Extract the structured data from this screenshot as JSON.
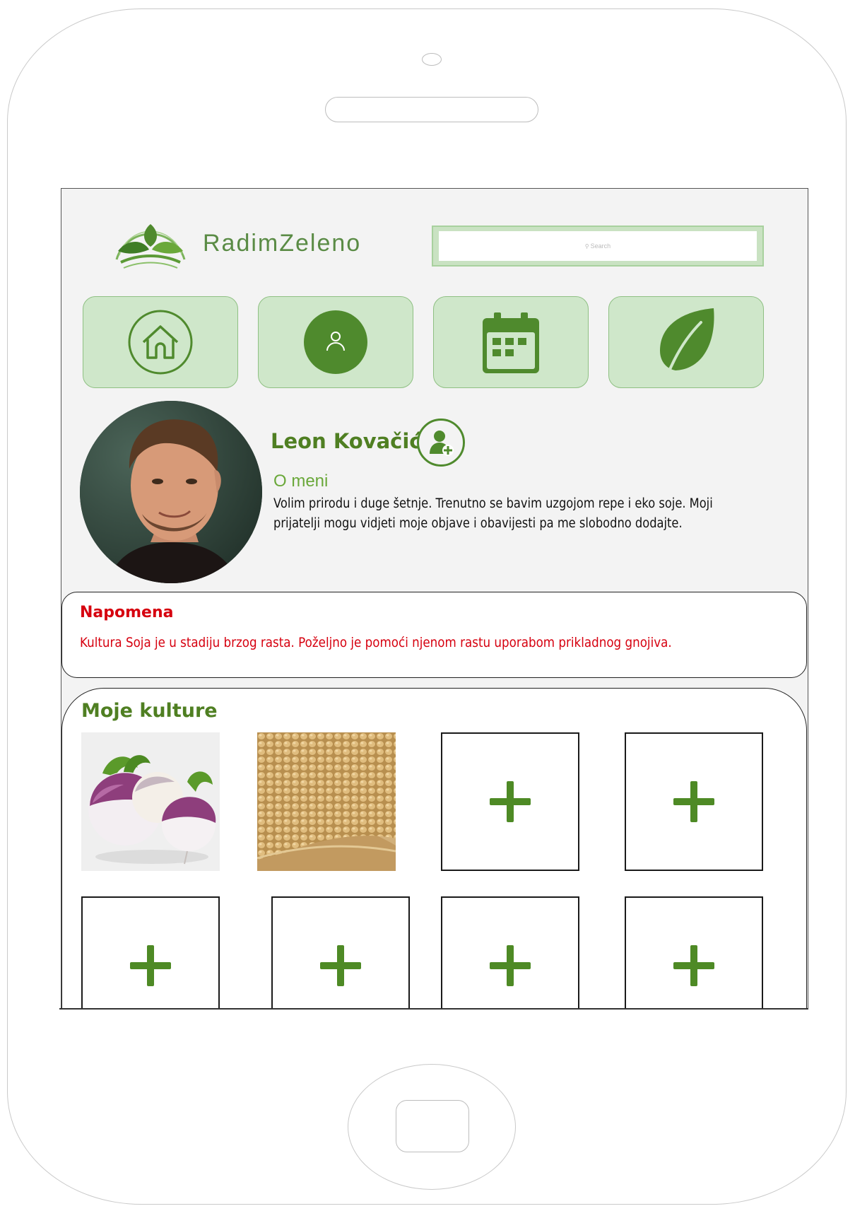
{
  "app": {
    "name": "RadimZeleno"
  },
  "search": {
    "placeholder": "Search"
  },
  "nav": {
    "items": [
      {
        "icon": "home-icon"
      },
      {
        "icon": "profile-icon"
      },
      {
        "icon": "calendar-icon"
      },
      {
        "icon": "leaf-icon"
      }
    ]
  },
  "profile": {
    "name": "Leon Kovačić",
    "about_title": "O meni",
    "about_text": "Volim prirodu i duge šetnje. Trenutno se bavim uzgojom repe i eko soje. Moji prijatelji mogu vidjeti moje objave i obavijesti pa me slobodno dodajte."
  },
  "note": {
    "title": "Napomena",
    "text": "Kultura Soja je u stadiju brzog rasta. Poželjno je pomoći njenom rastu uporabom prikladnog gnojiva."
  },
  "cultures": {
    "title": "Moje kulture",
    "tiles": [
      "turnip-image",
      "soybean-image",
      "add",
      "add",
      "add",
      "add",
      "add",
      "add"
    ]
  },
  "colors": {
    "accent": "#4f7f22",
    "nav_bg": "#cfe7ca",
    "warning": "#d6000f"
  }
}
